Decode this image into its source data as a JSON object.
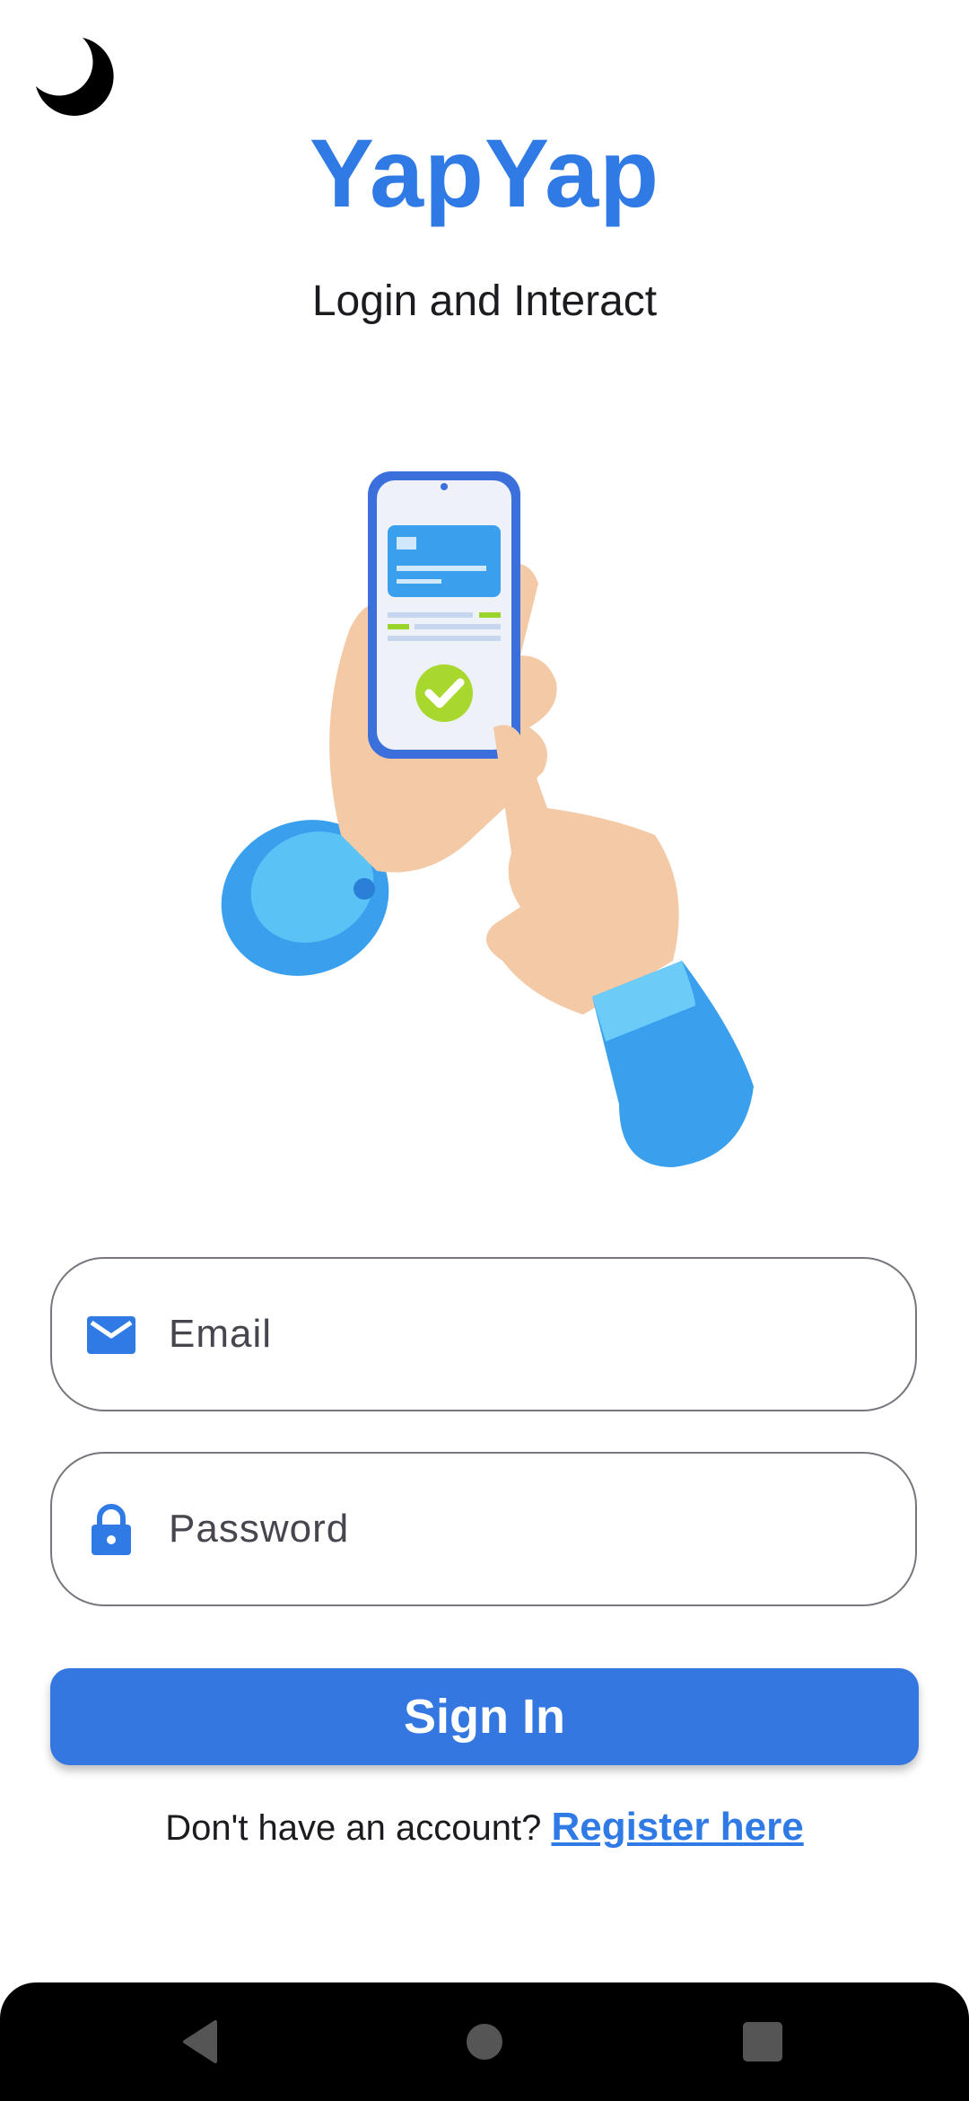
{
  "header": {
    "theme_toggle_icon": "moon-icon",
    "app_title": "YapYap",
    "subtitle": "Login and Interact"
  },
  "illustration": {
    "icon": "hand-phone-payment-illustration"
  },
  "form": {
    "email": {
      "icon": "mail-icon",
      "placeholder": "Email",
      "value": ""
    },
    "password": {
      "icon": "lock-icon",
      "placeholder": "Password",
      "value": ""
    },
    "sign_in_label": "Sign In"
  },
  "footer": {
    "prompt": "Don't have an account? ",
    "register_link": "Register here"
  },
  "navbar": {
    "back_icon": "back-triangle-icon",
    "home_icon": "home-circle-icon",
    "recents_icon": "recents-square-icon"
  },
  "colors": {
    "accent": "#2f7ae5",
    "button": "#3577e1",
    "field_border": "#79747e",
    "navbar": "#000000"
  }
}
